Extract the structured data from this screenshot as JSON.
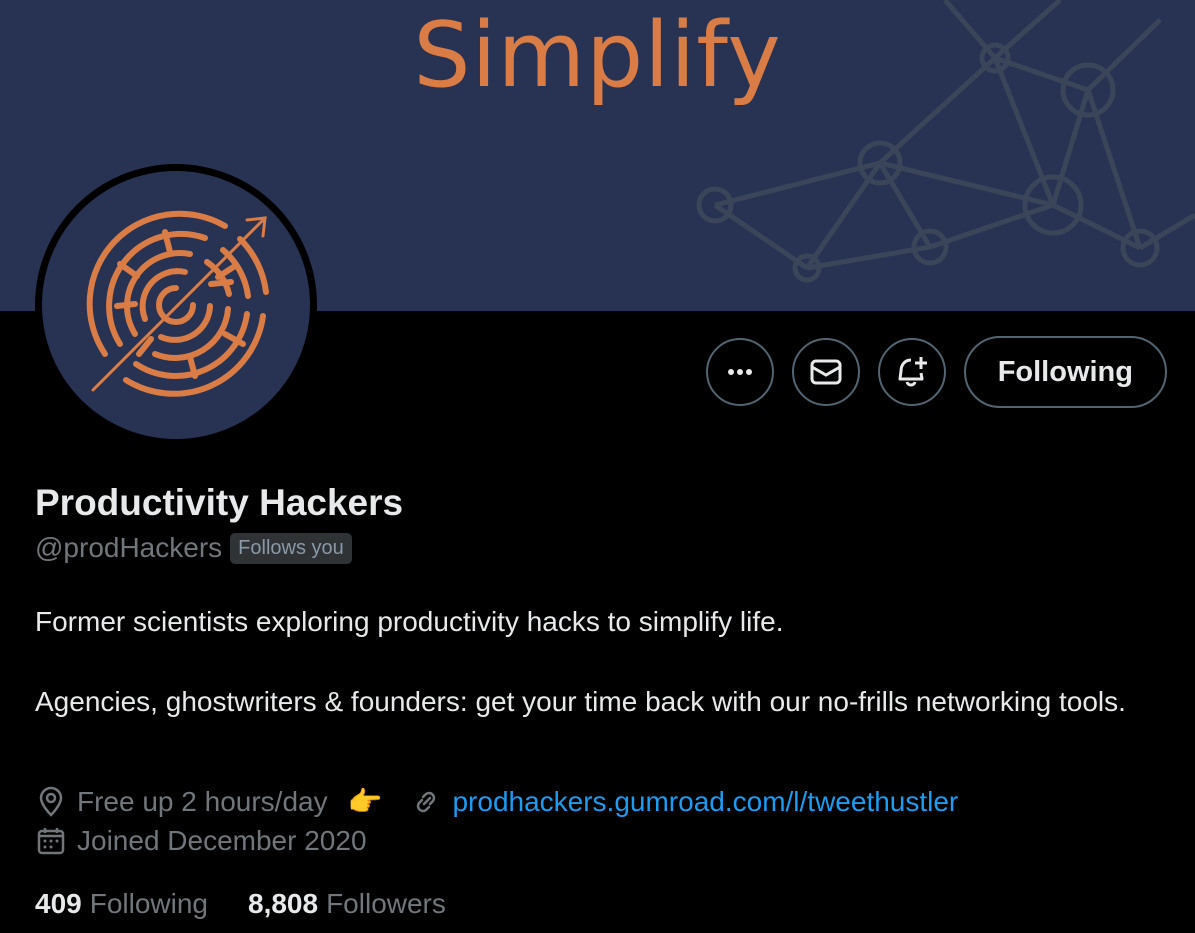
{
  "colors": {
    "banner_bg": "#283353",
    "banner_accent": "#d97c45",
    "network_lines": "#3b4559",
    "link": "#1d9bf0",
    "secondary_text": "#71767b"
  },
  "banner": {
    "title": "Simplify"
  },
  "avatar": {
    "icon": "maze-arrow-logo"
  },
  "actions": {
    "more_icon": "more-dots-icon",
    "message_icon": "envelope-icon",
    "notify_icon": "bell-plus-icon",
    "follow_label": "Following"
  },
  "profile": {
    "display_name": "Productivity Hackers",
    "handle": "@prodHackers",
    "follows_you": "Follows you",
    "bio": [
      "Former scientists exploring productivity hacks to simplify life.",
      "Agencies, ghostwriters & founders: get your time back with our no-frills networking tools."
    ],
    "location": "Free up 2 hours/day",
    "location_emoji": "👉",
    "website": "prodhackers.gumroad.com/l/tweethustler",
    "joined": "Joined December 2020"
  },
  "stats": {
    "following_count": "409",
    "following_label": "Following",
    "followers_count": "8,808",
    "followers_label": "Followers"
  }
}
